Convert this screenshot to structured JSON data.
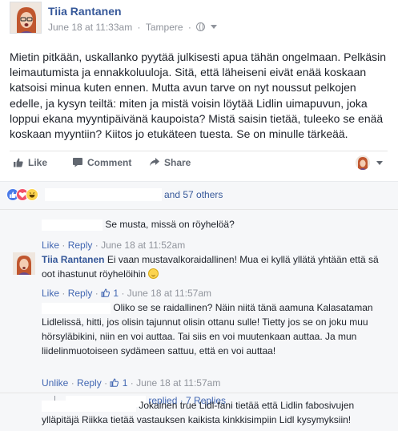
{
  "post": {
    "author": "Tiia Rantanen",
    "date": "June 18 at 11:33am",
    "separator": "·",
    "location": "Tampere",
    "privacy_icon": "globe-icon",
    "body": "Mietin pitkään, uskallanko pyytää julkisesti apua tähän ongelmaan. Pelkäsin leimautumista ja ennakkoluuloja. Sitä, että läheiseni eivät enää koskaan katsoisi minua kuten ennen. Mutta avun tarve on nyt noussut pelkojen edelle, ja kysyn teiltä: miten ja mistä voisin löytää Lidlin uimapuvun, joka loppui ekana myyntipäivänä kaupoista? Mistä saisin tietää, tuleeko se enää koskaan myyntiin? Kiitos jo etukäteen tuesta. Se on minulle tärkeää."
  },
  "actions": {
    "like": "Like",
    "comment": "Comment",
    "share": "Share"
  },
  "reactions": {
    "icons": [
      "like-reaction",
      "love-reaction",
      "haha-reaction"
    ],
    "count_text": "and 57 others"
  },
  "comments": [
    {
      "author": "",
      "text": "Se musta, missä on röyhelöä?",
      "like": "Like",
      "reply": "Reply",
      "sep": "·",
      "time": "June 18 at 11:52am"
    },
    {
      "author": "Tiia Rantanen",
      "text": "Ei vaan mustavalkoraidallinen! Mua ei kyllä yllätä yhtään että sä oot ihastunut röyhelöihin",
      "like": "Like",
      "reply": "Reply",
      "sep": "·",
      "likes": "1",
      "time": "June 18 at 11:57am"
    },
    {
      "author": "",
      "text": "Oliko se se raidallinen? Näin niitä tänä aamuna Kalasataman Lidlelissä, hitti, jos olisin tajunnut olisin ottanu sulle! Tietty jos se on joku muu hörsyläbikini, niin en voi auttaa. Tai siis en voi muutenkaan auttaa. Ja mun liidelinmuotoiseen sydämeen sattuu, että en voi auttaa!",
      "unlike": "Unlike",
      "reply": "Reply",
      "sep": "·",
      "likes": "1",
      "time": "June 18 at 11:57am",
      "replies": "replied · 7 Replies"
    },
    {
      "author": "",
      "text": "Jokainen true Lidl-fani tietää että Lidlin fabosivujen ylläpitäjä Riikka tietää vastauksen kaikista kinkkisimpiin Lidl kysymyksiin!"
    }
  ],
  "colors": {
    "link": "#365899",
    "meta": "#90949c",
    "comments_bg": "#f6f7f9"
  }
}
